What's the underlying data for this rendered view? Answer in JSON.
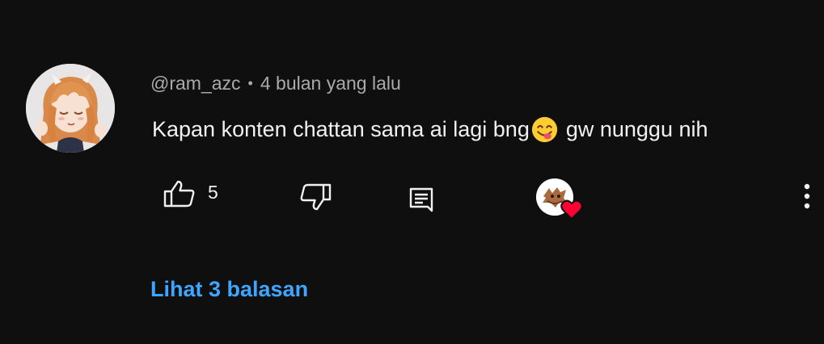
{
  "comment": {
    "author": "@ram_azc",
    "separator": "•",
    "time": "4 bulan yang lalu",
    "text_before_emoji": "Kapan konten chattan sama ai lagi bng",
    "emoji": "face-savoring-food-emoji",
    "text_after_emoji": "gw nunggu nih",
    "avatar": "anime-girl-avatar"
  },
  "actions": {
    "like_icon": "thumb-up-icon",
    "like_count": "5",
    "dislike_icon": "thumb-down-icon",
    "reply_icon": "reply-comment-icon",
    "creator_heart_icon": "creator-heart-icon",
    "more_icon": "more-vertical-icon"
  },
  "replies": {
    "label": "Lihat 3 balasan"
  },
  "colors": {
    "background": "#0f0f0f",
    "text_primary": "#f1f1f1",
    "text_secondary": "#aaaaaa",
    "link": "#3ea6ff",
    "heart": "#ff0033"
  }
}
